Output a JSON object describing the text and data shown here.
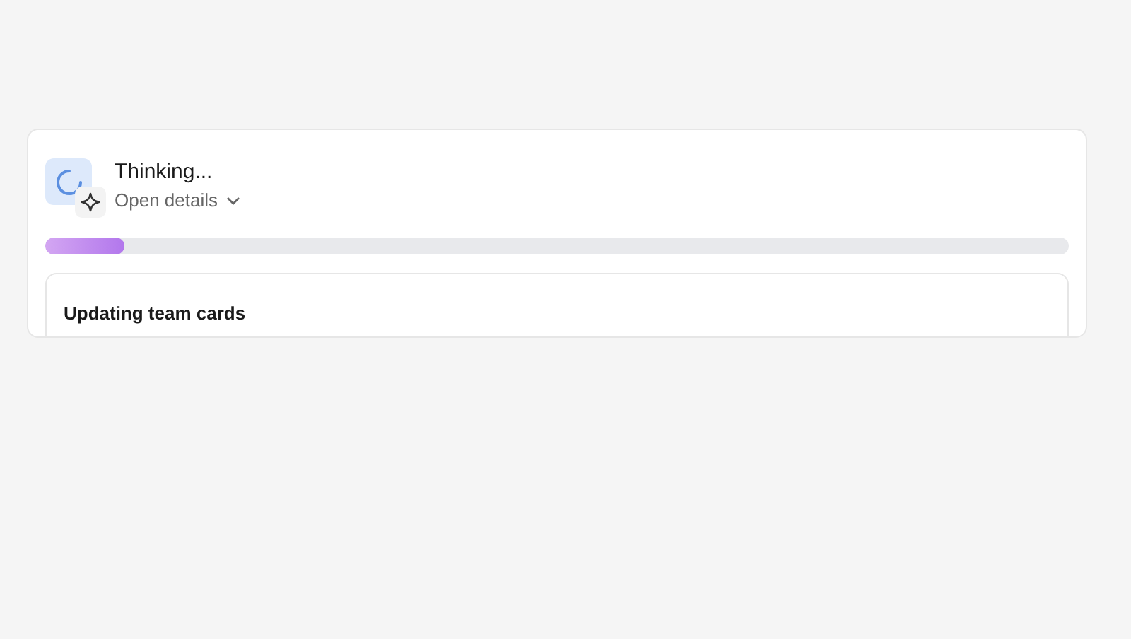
{
  "status": {
    "title": "Thinking...",
    "details_link": "Open details",
    "expanded": false
  },
  "progress": {
    "level": 0.077
  },
  "task_card": {
    "title": "Updating team cards"
  }
}
